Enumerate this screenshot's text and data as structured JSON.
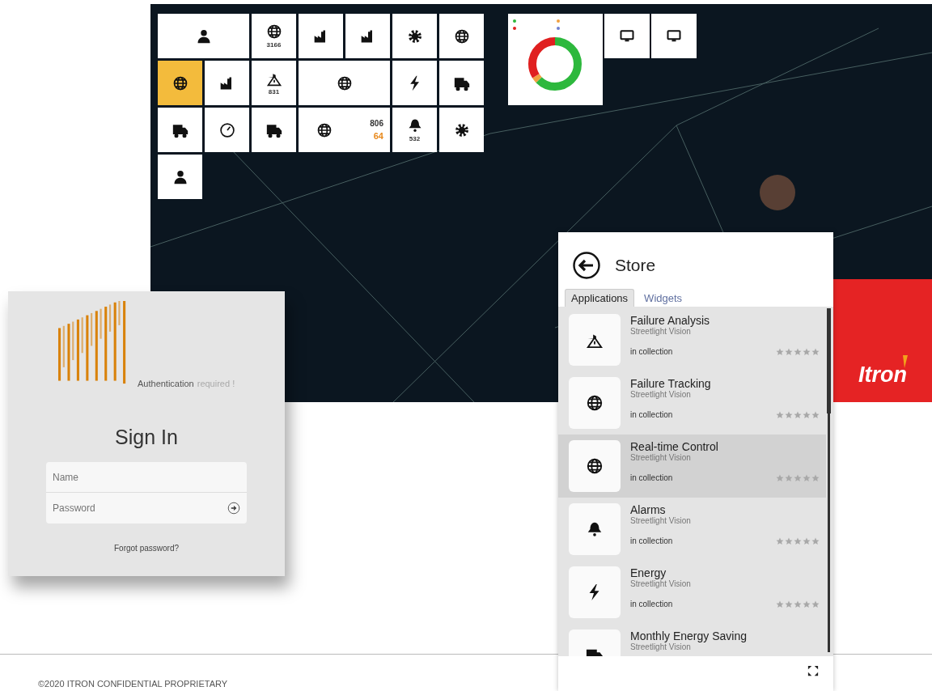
{
  "dashboard": {
    "tiles": [
      {
        "kind": "user",
        "selected": false
      },
      {
        "kind": "app",
        "count": "3166",
        "selected": false
      },
      {
        "kind": "app",
        "selected": false
      },
      {
        "kind": "app",
        "selected": false
      },
      {
        "kind": "app",
        "selected": false
      },
      {
        "kind": "app",
        "selected": false
      },
      {
        "kind": "app",
        "selected": true
      },
      {
        "kind": "app",
        "selected": false
      },
      {
        "kind": "app",
        "count": "831",
        "selected": false
      },
      {
        "kind": "wide",
        "selected": false
      },
      {
        "kind": "app",
        "selected": false
      },
      {
        "kind": "app",
        "selected": false
      },
      {
        "kind": "app",
        "selected": false
      },
      {
        "kind": "app",
        "selected": false
      },
      {
        "kind": "app",
        "selected": false
      },
      {
        "kind": "stat",
        "value": "806",
        "alert_value": "64",
        "selected": false
      },
      {
        "kind": "app",
        "count": "532",
        "selected": false
      },
      {
        "kind": "app",
        "selected": false
      },
      {
        "kind": "app",
        "selected": false
      }
    ],
    "widgets": [
      {
        "kind": "donut"
      },
      {
        "kind": "monitor"
      },
      {
        "kind": "monitor"
      }
    ],
    "brand": {
      "logo": "Itron"
    }
  },
  "login": {
    "auth_label": "Authentication",
    "auth_detail": "required !",
    "title": "Sign In",
    "name_field": {
      "placeholder": "Name"
    },
    "password_field": {
      "placeholder": "Password"
    },
    "forgot_link": "Forgot password?"
  },
  "store": {
    "title": "Store",
    "tabs": [
      {
        "label": "Applications",
        "selected": true
      },
      {
        "label": "Widgets",
        "selected": false
      }
    ],
    "apps": [
      {
        "name": "Failure Analysis",
        "vendor": "Streetlight Vision",
        "status": "in collection",
        "stars": 0,
        "selected": false
      },
      {
        "name": "Failure Tracking",
        "vendor": "Streetlight Vision",
        "status": "in collection",
        "stars": 0,
        "selected": false
      },
      {
        "name": "Real-time Control",
        "vendor": "Streetlight Vision",
        "status": "in collection",
        "stars": 0,
        "selected": true
      },
      {
        "name": "Alarms",
        "vendor": "Streetlight Vision",
        "status": "in collection",
        "stars": 0,
        "selected": false
      },
      {
        "name": "Energy",
        "vendor": "Streetlight Vision",
        "status": "in collection",
        "stars": 0,
        "selected": false
      },
      {
        "name": "Monthly Energy Saving",
        "vendor": "Streetlight Vision",
        "selected": false
      }
    ]
  },
  "footer": {
    "copyright": "©2020  ITRON CONFIDENTIAL PROPRIETARY"
  }
}
